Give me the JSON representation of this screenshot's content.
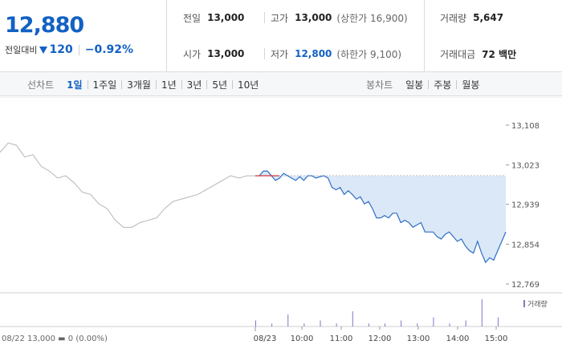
{
  "quote": {
    "price": "12,880",
    "change_label": "전일대비",
    "change_value": "120",
    "change_rate": "−0.92%",
    "prev_close": {
      "label": "전일",
      "value": "13,000"
    },
    "high": {
      "label": "고가",
      "value": "13,000",
      "limit_text": "(상한가 16,900)"
    },
    "volume": {
      "label": "거래량",
      "value": "5,647"
    },
    "open": {
      "label": "시가",
      "value": "13,000"
    },
    "low": {
      "label": "저가",
      "value": "12,800",
      "limit_text": "(하한가 9,100)"
    },
    "amount": {
      "label": "거래대금",
      "value": "72 백만"
    },
    "colors": {
      "down": "#1261c4",
      "up": "#d62424"
    }
  },
  "toolbar": {
    "line_chart_label": "선차트",
    "line_options": [
      "1일",
      "1주일",
      "3개월",
      "1년",
      "3년",
      "5년",
      "10년"
    ],
    "line_active": "1일",
    "candle_chart_label": "봉차트",
    "candle_options": [
      "일봉",
      "주봉",
      "월봉"
    ]
  },
  "chart_data": {
    "type": "line",
    "y_ticks": [
      "13,108",
      "13,023",
      "12,939",
      "12,854",
      "12,769"
    ],
    "ylim": [
      12769,
      13108
    ],
    "x_ticks": [
      "08/23",
      "10:00",
      "11:00",
      "12:00",
      "13:00",
      "14:00",
      "15:00"
    ],
    "prev_day_label": "08/22  13,000 ▬ 0 (0.00%)",
    "reference_price": 13000,
    "volume_legend": "거래량",
    "colors": {
      "today": "#2f6fc4",
      "prev_day": "#b5b5b5",
      "fill": "#dbe8f8",
      "up": "#d62424",
      "volume": "#8a70c8"
    },
    "series": [
      {
        "x": [
          0,
          5,
          10,
          15,
          20,
          25,
          30,
          35,
          40,
          45,
          50,
          55,
          60,
          65,
          70,
          75,
          80,
          85,
          90,
          95,
          100,
          105,
          110,
          115,
          120,
          125,
          130,
          135,
          140,
          145,
          150,
          155,
          160,
          165,
          170,
          175,
          180,
          185,
          190,
          195,
          200,
          205,
          210,
          215,
          220,
          225,
          230,
          235,
          240,
          245,
          250,
          255,
          260,
          265,
          270,
          275,
          280,
          285,
          290,
          295,
          300,
          305,
          310
        ],
        "values": [
          13000,
          13000,
          13010,
          13010,
          13000,
          12990,
          12995,
          13005,
          13000,
          12995,
          12990,
          12998,
          12990,
          13000,
          13000,
          12995,
          12998,
          13000,
          12995,
          12975,
          12970,
          12975,
          12960,
          12968,
          12960,
          12950,
          12955,
          12940,
          12945,
          12930,
          12910,
          12910,
          12915,
          12910,
          12920,
          12920,
          12900,
          12905,
          12900,
          12890,
          12895,
          12900,
          12880,
          12880,
          12880,
          12870,
          12865,
          12875,
          12880,
          12870,
          12860,
          12865,
          12850,
          12840,
          12835,
          12860,
          12835,
          12815,
          12825,
          12820,
          12840,
          12860,
          12880
        ]
      },
      {
        "name": "08/22",
        "x": [
          0,
          10,
          20,
          30,
          40,
          50,
          60,
          70,
          80,
          90,
          100,
          110,
          120,
          130,
          140,
          150,
          160,
          170,
          180,
          190,
          200,
          210,
          220,
          230,
          240,
          250,
          260,
          270,
          280,
          290,
          300,
          310
        ],
        "values": [
          13050,
          13070,
          13065,
          13040,
          13045,
          13020,
          13010,
          12995,
          13000,
          12985,
          12965,
          12960,
          12940,
          12930,
          12905,
          12890,
          12890,
          12900,
          12905,
          12910,
          12930,
          12945,
          12950,
          12955,
          12960,
          12970,
          12980,
          12990,
          13000,
          12995,
          13000,
          13000
        ]
      }
    ],
    "volume": {
      "x": [
        0,
        20,
        40,
        60,
        80,
        100,
        120,
        140,
        160,
        180,
        200,
        220,
        240,
        260,
        280,
        300
      ],
      "values": [
        2,
        1,
        4,
        1,
        2,
        1,
        5,
        1,
        1,
        2,
        1,
        3,
        1,
        2,
        9,
        3
      ]
    }
  }
}
